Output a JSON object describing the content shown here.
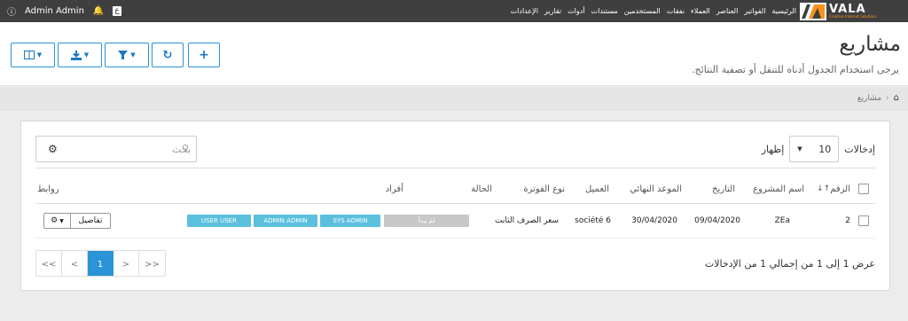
{
  "topbar": {
    "user_name": "Admin Admin",
    "lang_badge": "ع",
    "nav_items": [
      "الرئيسية",
      "الفواتير",
      "العناصر",
      "العملاء",
      "نفقات",
      "المستخدمين",
      "مستندات",
      "أدوات",
      "تقارير",
      "الإعدادات"
    ],
    "logo_text": "VALA",
    "logo_tagline": "Creative Internet Solutions"
  },
  "header": {
    "title": "مشاريع",
    "subtitle": "يرجى استخدام الجدول أدناه للتنقل أو تصفية النتائج."
  },
  "breadcrumb": {
    "current": "مشاريع"
  },
  "table_controls": {
    "search_placeholder": "بحث",
    "show_label": "إظهار",
    "entries_label": "إدخالات",
    "page_size": "10"
  },
  "table": {
    "columns": [
      "الرقم",
      "اسم المشروع",
      "التاريخ",
      "الموعد النهائي",
      "العميل",
      "نوع الفوترة",
      "الحالة",
      "أفراد",
      "روابط"
    ],
    "rows": [
      {
        "id": "2",
        "name": "ZEa",
        "date": "09/04/2020",
        "deadline": "30/04/2020",
        "client": "société 6",
        "billing_type": "سعر الصرف الثابت",
        "status": "لم يبدأ",
        "members": [
          "SYS ADMIN",
          "ADMIN ADMIN",
          "USER USER"
        ],
        "details_label": "تفاصيل"
      }
    ]
  },
  "pagination": {
    "first": "<<",
    "prev": "<",
    "current": "1",
    "next": ">",
    "last": ">>"
  },
  "footer_info": "عرض 1 إلى 1 من إجمالي 1 من الإدخالات",
  "colors": {
    "accent": "#2a94d6",
    "topbar": "#3f3f3f",
    "status_grey": "#c8c8c8",
    "member_blue": "#5bc0de"
  }
}
